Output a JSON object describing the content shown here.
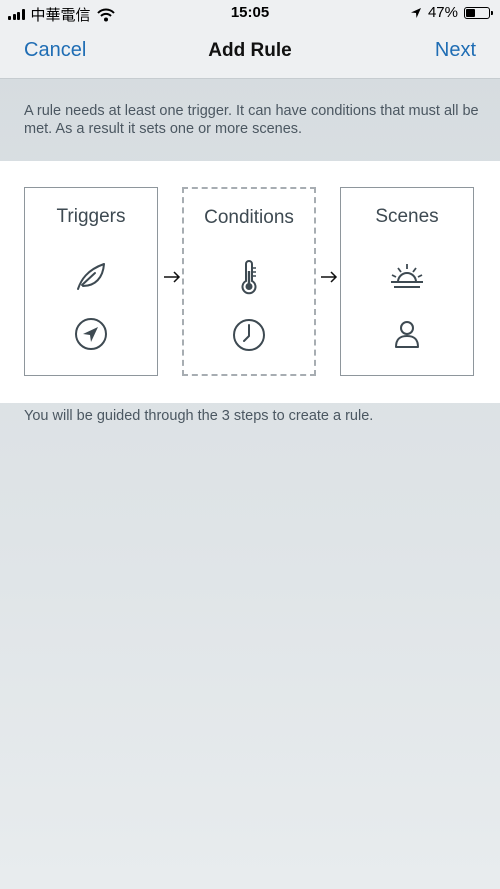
{
  "status_bar": {
    "carrier": "中華電信",
    "time": "15:05",
    "battery": "47%",
    "battery_level": 0.47,
    "icons": [
      "signal-icon",
      "wifi-icon",
      "location-arrow-icon",
      "battery-icon"
    ]
  },
  "nav": {
    "cancel_label": "Cancel",
    "title": "Add Rule",
    "next_label": "Next"
  },
  "intro_text": "A rule needs at least one trigger. It can have conditions that must all be met. As a result it sets one or more scenes.",
  "steps": [
    {
      "title": "Triggers",
      "icons": [
        "leaf-icon",
        "navigation-arrow-icon"
      ]
    },
    {
      "title": "Conditions",
      "icons": [
        "thermometer-icon",
        "clock-icon"
      ]
    },
    {
      "title": "Scenes",
      "icons": [
        "sunrise-icon",
        "person-icon"
      ]
    }
  ],
  "footer_text": "You will be guided through the 3 steps to create a rule.",
  "colors": {
    "accent": "#1f6db4",
    "icon": "#3e4a52",
    "card_border": "#8e969c"
  }
}
